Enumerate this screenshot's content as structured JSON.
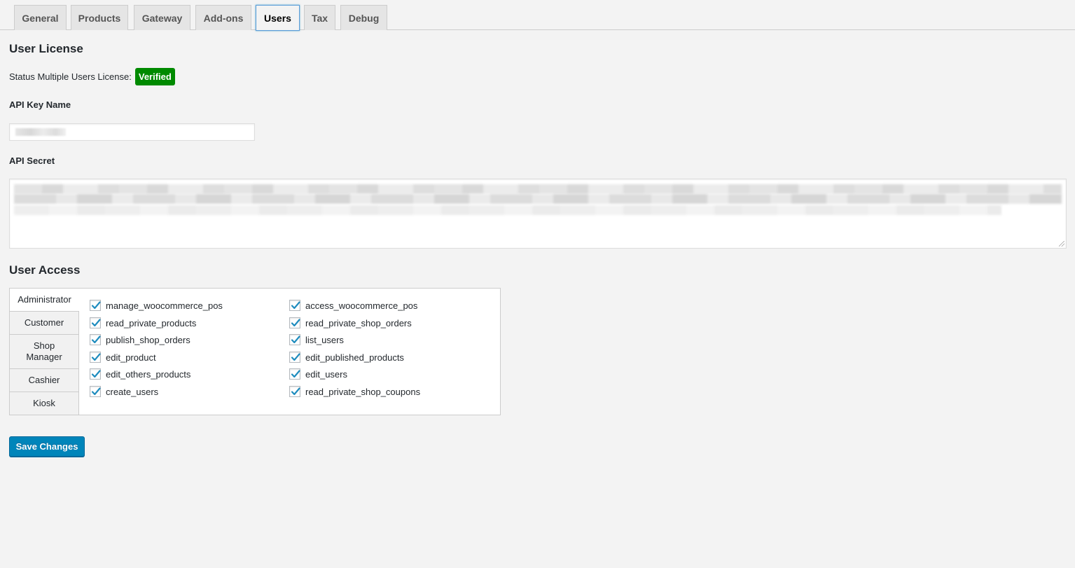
{
  "tabs": [
    {
      "label": "General"
    },
    {
      "label": "Products"
    },
    {
      "label": "Gateway"
    },
    {
      "label": "Add-ons"
    },
    {
      "label": "Users",
      "active": true
    },
    {
      "label": "Tax"
    },
    {
      "label": "Debug"
    }
  ],
  "license": {
    "heading": "User License",
    "status_label": "Status Multiple Users License:",
    "status_badge": "Verified",
    "badge_color": "#008a00",
    "api_key_label": "API Key Name",
    "api_secret_label": "API Secret"
  },
  "access": {
    "heading": "User Access",
    "roles": [
      "Administrator",
      "Customer",
      "Shop Manager",
      "Cashier",
      "Kiosk"
    ],
    "active_role": "Administrator",
    "capabilities_left": [
      {
        "name": "manage_woocommerce_pos",
        "checked": true
      },
      {
        "name": "read_private_products",
        "checked": true
      },
      {
        "name": "publish_shop_orders",
        "checked": true
      },
      {
        "name": "edit_product",
        "checked": true
      },
      {
        "name": "edit_others_products",
        "checked": true
      },
      {
        "name": "create_users",
        "checked": true
      }
    ],
    "capabilities_right": [
      {
        "name": "access_woocommerce_pos",
        "checked": true
      },
      {
        "name": "read_private_shop_orders",
        "checked": true
      },
      {
        "name": "list_users",
        "checked": true
      },
      {
        "name": "edit_published_products",
        "checked": true
      },
      {
        "name": "edit_users",
        "checked": true
      },
      {
        "name": "read_private_shop_coupons",
        "checked": true
      }
    ]
  },
  "save_label": "Save Changes",
  "colors": {
    "accent": "#0085ba",
    "checkmark": "#1e8cbe",
    "active_tab_border": "#5b9dd9"
  }
}
